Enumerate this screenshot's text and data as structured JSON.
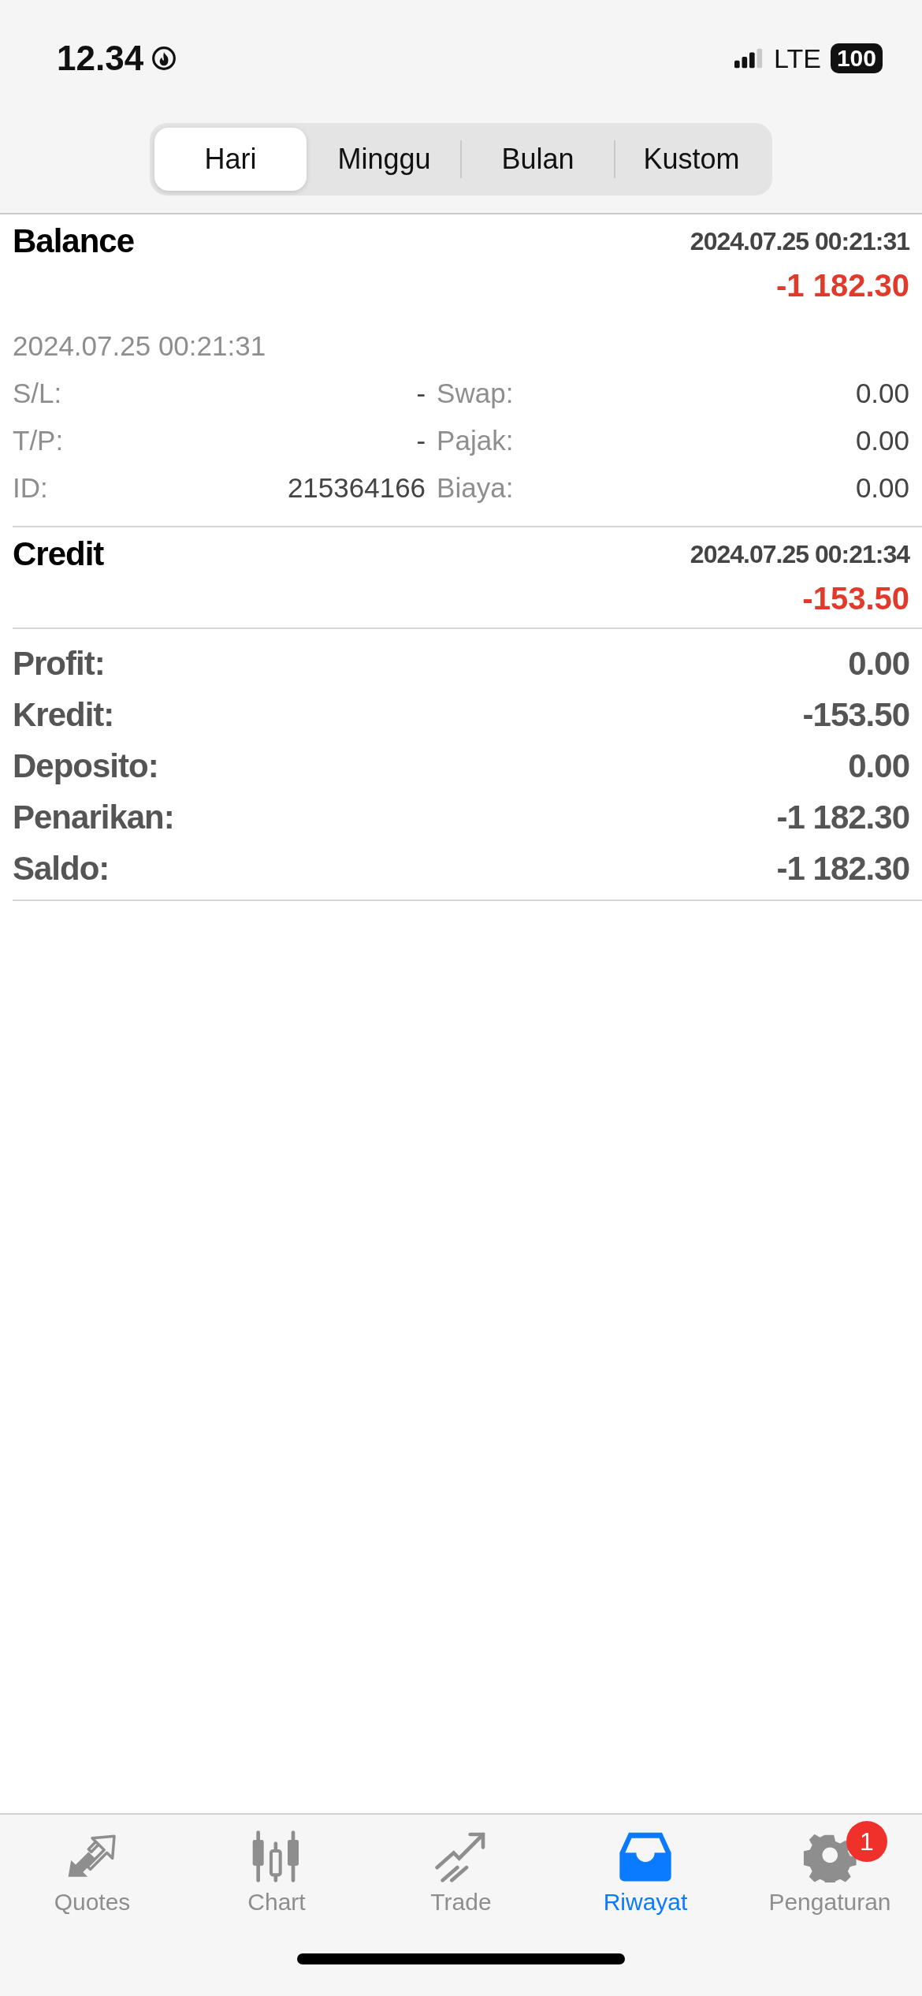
{
  "status_bar": {
    "time": "12.34",
    "network": "LTE",
    "battery": "100"
  },
  "tabs": [
    {
      "label": "Hari",
      "selected": true
    },
    {
      "label": "Minggu",
      "selected": false
    },
    {
      "label": "Bulan",
      "selected": false
    },
    {
      "label": "Kustom",
      "selected": false
    }
  ],
  "deals": [
    {
      "title": "Balance",
      "time": "2024.07.25 00:21:31",
      "amount": "-1 182.30",
      "details": {
        "time": "2024.07.25 00:21:31",
        "rows": [
          [
            {
              "label": "S/L:",
              "value": "-"
            },
            {
              "label": "Swap:",
              "value": "0.00"
            }
          ],
          [
            {
              "label": "T/P:",
              "value": "-"
            },
            {
              "label": "Pajak:",
              "value": "0.00"
            }
          ],
          [
            {
              "label": "ID:",
              "value": "215364166"
            },
            {
              "label": "Biaya:",
              "value": "0.00"
            }
          ]
        ]
      }
    },
    {
      "title": "Credit",
      "time": "2024.07.25 00:21:34",
      "amount": "-153.50"
    }
  ],
  "summary": [
    {
      "label": "Profit:",
      "value": "0.00"
    },
    {
      "label": "Kredit:",
      "value": "-153.50"
    },
    {
      "label": "Deposito:",
      "value": "0.00"
    },
    {
      "label": "Penarikan:",
      "value": "-1 182.30"
    },
    {
      "label": "Saldo:",
      "value": "-1 182.30"
    }
  ],
  "nav": [
    {
      "label": "Quotes",
      "selected": false
    },
    {
      "label": "Chart",
      "selected": false
    },
    {
      "label": "Trade",
      "selected": false
    },
    {
      "label": "Riwayat",
      "selected": true
    },
    {
      "label": "Pengaturan",
      "selected": false,
      "badge": "1"
    }
  ]
}
